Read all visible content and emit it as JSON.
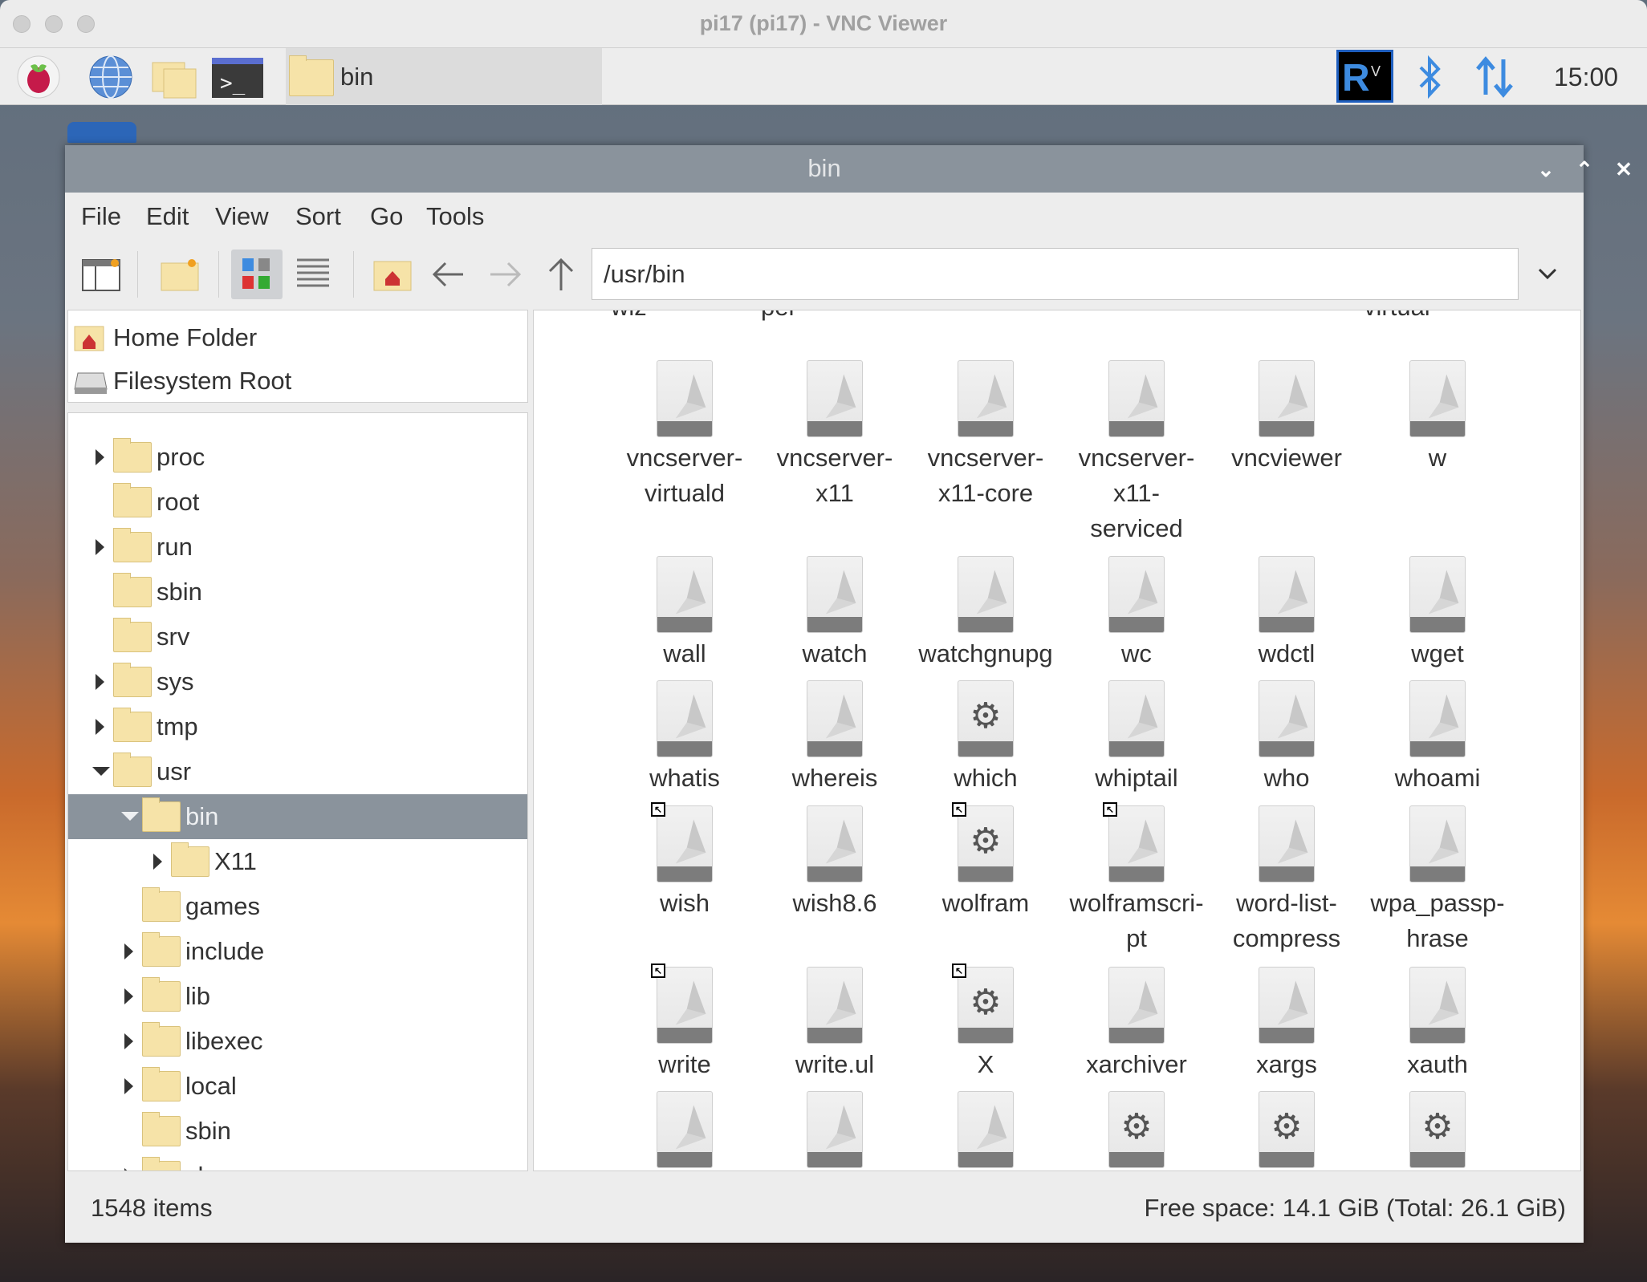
{
  "vnc_window": {
    "title": "pi17 (pi17) - VNC Viewer"
  },
  "taskbar": {
    "launchers": [
      "raspberry-menu-icon",
      "web-browser-icon",
      "file-manager-icon",
      "terminal-icon"
    ],
    "task_label": "bin",
    "tray": [
      "vnc-icon",
      "bluetooth-icon",
      "network-icon"
    ],
    "clock": "15:00"
  },
  "file_manager": {
    "title": "bin",
    "menu": [
      "File",
      "Edit",
      "View",
      "Sort",
      "Go",
      "Tools"
    ],
    "path": "/usr/bin",
    "places": [
      {
        "label": "Home Folder",
        "icon": "home-icon"
      },
      {
        "label": "Filesystem Root",
        "icon": "drive-icon"
      }
    ],
    "tree": [
      {
        "label": "proc",
        "level": 0,
        "expander": "collapsed"
      },
      {
        "label": "root",
        "level": 0,
        "expander": "none"
      },
      {
        "label": "run",
        "level": 0,
        "expander": "collapsed"
      },
      {
        "label": "sbin",
        "level": 0,
        "expander": "none"
      },
      {
        "label": "srv",
        "level": 0,
        "expander": "none"
      },
      {
        "label": "sys",
        "level": 0,
        "expander": "collapsed"
      },
      {
        "label": "tmp",
        "level": 0,
        "expander": "collapsed"
      },
      {
        "label": "usr",
        "level": 0,
        "expander": "expanded"
      },
      {
        "label": "bin",
        "level": 1,
        "expander": "expanded",
        "selected": true
      },
      {
        "label": "X11",
        "level": 2,
        "expander": "collapsed"
      },
      {
        "label": "games",
        "level": 1,
        "expander": "none"
      },
      {
        "label": "include",
        "level": 1,
        "expander": "collapsed"
      },
      {
        "label": "lib",
        "level": 1,
        "expander": "collapsed"
      },
      {
        "label": "libexec",
        "level": 1,
        "expander": "collapsed"
      },
      {
        "label": "local",
        "level": 1,
        "expander": "collapsed"
      },
      {
        "label": "sbin",
        "level": 1,
        "expander": "none"
      },
      {
        "label": "share",
        "level": 1,
        "expander": "collapsed"
      }
    ],
    "partial_top_labels": [
      "wiz",
      "per",
      "",
      "",
      "",
      "virtual"
    ],
    "rows": [
      [
        {
          "label": "vncserver-\nvirtuald",
          "icon": "script"
        },
        {
          "label": "vncserver-\nx11",
          "icon": "script"
        },
        {
          "label": "vncserver-\nx11-core",
          "icon": "script"
        },
        {
          "label": "vncserver-\nx11-\nserviced",
          "icon": "script"
        },
        {
          "label": "vncviewer",
          "icon": "script"
        },
        {
          "label": "w",
          "icon": "script"
        }
      ],
      [
        {
          "label": "wall",
          "icon": "script"
        },
        {
          "label": "watch",
          "icon": "script"
        },
        {
          "label": "watchgnupg",
          "icon": "script"
        },
        {
          "label": "wc",
          "icon": "script"
        },
        {
          "label": "wdctl",
          "icon": "script"
        },
        {
          "label": "wget",
          "icon": "script"
        }
      ],
      [
        {
          "label": "whatis",
          "icon": "script"
        },
        {
          "label": "whereis",
          "icon": "script"
        },
        {
          "label": "which",
          "icon": "gear"
        },
        {
          "label": "whiptail",
          "icon": "script"
        },
        {
          "label": "who",
          "icon": "script"
        },
        {
          "label": "whoami",
          "icon": "script"
        }
      ],
      [
        {
          "label": "wish",
          "icon": "script",
          "link": true
        },
        {
          "label": "wish8.6",
          "icon": "script"
        },
        {
          "label": "wolfram",
          "icon": "gear",
          "link": true
        },
        {
          "label": "wolframscri-\npt",
          "icon": "script",
          "link": true
        },
        {
          "label": "word-list-\ncompress",
          "icon": "script"
        },
        {
          "label": "wpa_passp-\nhrase",
          "icon": "script"
        }
      ],
      [
        {
          "label": "write",
          "icon": "script",
          "link": true
        },
        {
          "label": "write.ul",
          "icon": "script"
        },
        {
          "label": "X",
          "icon": "gear",
          "link": true
        },
        {
          "label": "xarchiver",
          "icon": "script"
        },
        {
          "label": "xargs",
          "icon": "script"
        },
        {
          "label": "xauth",
          "icon": "script"
        }
      ],
      [
        {
          "label": "",
          "icon": "script"
        },
        {
          "label": "",
          "icon": "script"
        },
        {
          "label": "",
          "icon": "script"
        },
        {
          "label": "",
          "icon": "gear"
        },
        {
          "label": "",
          "icon": "gear"
        },
        {
          "label": "",
          "icon": "gear"
        }
      ]
    ],
    "status": {
      "count": "1548 items",
      "free_space": "Free space: 14.1 GiB (Total: 26.1 GiB)"
    }
  }
}
